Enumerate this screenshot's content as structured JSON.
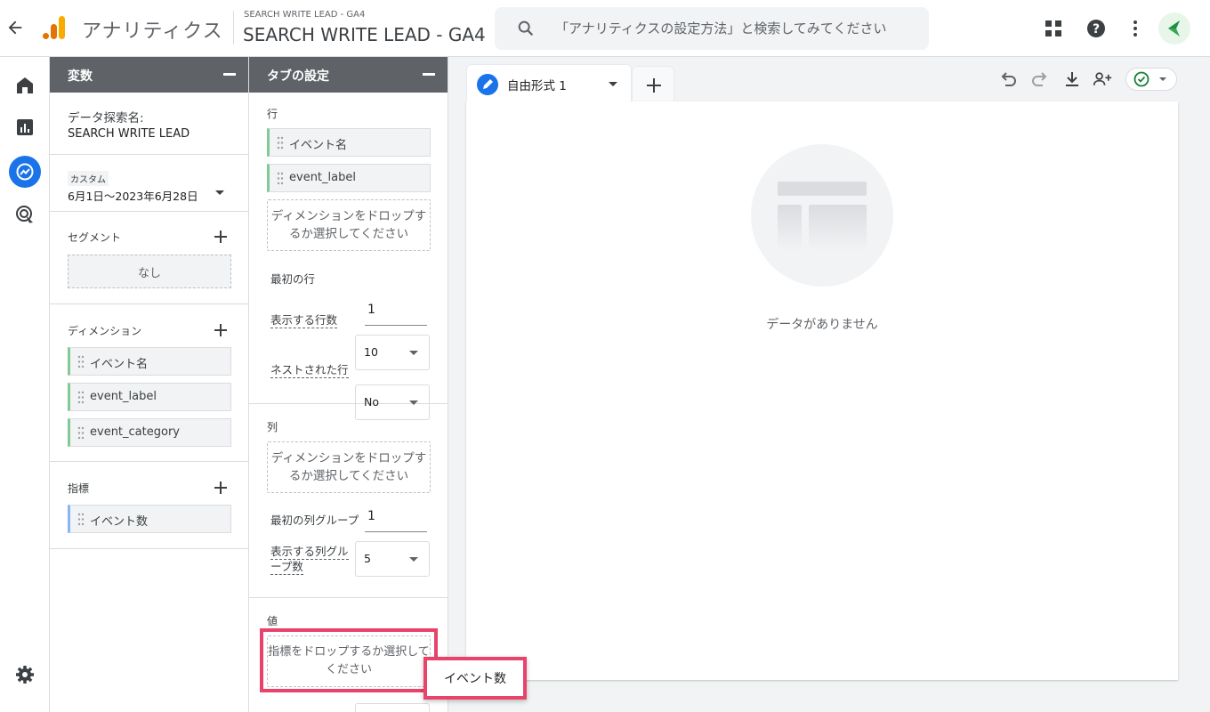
{
  "header": {
    "app_name": "アナリティクス",
    "property_sub": "SEARCH WRITE LEAD - GA4",
    "property_main": "SEARCH WRITE LEAD - GA4",
    "search_placeholder": "「アナリティクスの設定方法」と検索してみてください"
  },
  "nav": {
    "items": [
      "home-icon",
      "reports-icon",
      "explore-icon",
      "advertising-icon"
    ],
    "active": "explore-icon",
    "settings": "gear-icon"
  },
  "variables": {
    "title": "変数",
    "exploration_name_label": "データ探索名:",
    "exploration_name": "SEARCH WRITE LEAD",
    "date_tag": "カスタム",
    "date_range": "6月1日～2023年6月28日",
    "segments_label": "セグメント",
    "segments_empty": "なし",
    "dimensions_label": "ディメンション",
    "dimensions": [
      "イベント名",
      "event_label",
      "event_category"
    ],
    "metrics_label": "指標",
    "metrics": [
      "イベント数"
    ]
  },
  "tab_settings": {
    "title": "タブの設定",
    "rows_label": "行",
    "rows": [
      "イベント名",
      "event_label"
    ],
    "drop_dimension": "ディメンションをドロップするか選択してください",
    "first_row_label": "最初の行",
    "first_row_value": "1",
    "show_rows_label": "表示する行数",
    "show_rows_value": "10",
    "nested_rows_label": "ネストされた行",
    "nested_rows_value": "No",
    "columns_label": "列",
    "drop_dimension_col": "ディメンションをドロップするか選択してください",
    "first_col_group_label": "最初の列グループ",
    "first_col_group_value": "1",
    "show_col_groups_label": "表示する列グループ数",
    "show_col_groups_value": "5",
    "values_label": "値",
    "drop_metric": "指標をドロップするか選択してください"
  },
  "canvas": {
    "tab_label": "自由形式 1",
    "empty_message": "データがありません"
  },
  "drag_tooltip": "イベント数",
  "colors": {
    "accent": "#1a73e8",
    "dimension_chip": "#81c995",
    "metric_chip": "#8ab4f8",
    "highlight": "#e8436b"
  }
}
